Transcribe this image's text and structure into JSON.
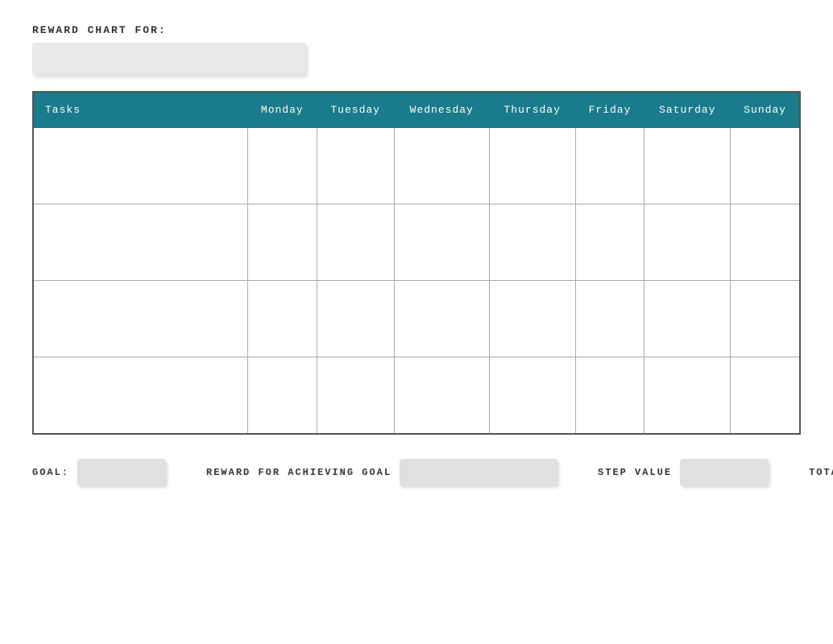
{
  "header": {
    "title": "REWARD CHART FOR:",
    "name_placeholder": ""
  },
  "table": {
    "columns": [
      {
        "id": "tasks",
        "label": "Tasks"
      },
      {
        "id": "monday",
        "label": "Monday"
      },
      {
        "id": "tuesday",
        "label": "Tuesday"
      },
      {
        "id": "wednesday",
        "label": "Wednesday"
      },
      {
        "id": "thursday",
        "label": "Thursday"
      },
      {
        "id": "friday",
        "label": "Friday"
      },
      {
        "id": "saturday",
        "label": "Saturday"
      },
      {
        "id": "sunday",
        "label": "Sunday"
      }
    ],
    "rows": [
      {
        "id": 1
      },
      {
        "id": 2
      },
      {
        "id": 3
      },
      {
        "id": 4
      }
    ]
  },
  "footer": {
    "goal_label": "GOAL:",
    "reward_label": "REWARD FOR ACHIEVING GOAL",
    "step_label": "STEP VALUE",
    "total_label": "TOTAL",
    "goal_value": "",
    "reward_value": "",
    "step_value": "",
    "total_value": ""
  }
}
